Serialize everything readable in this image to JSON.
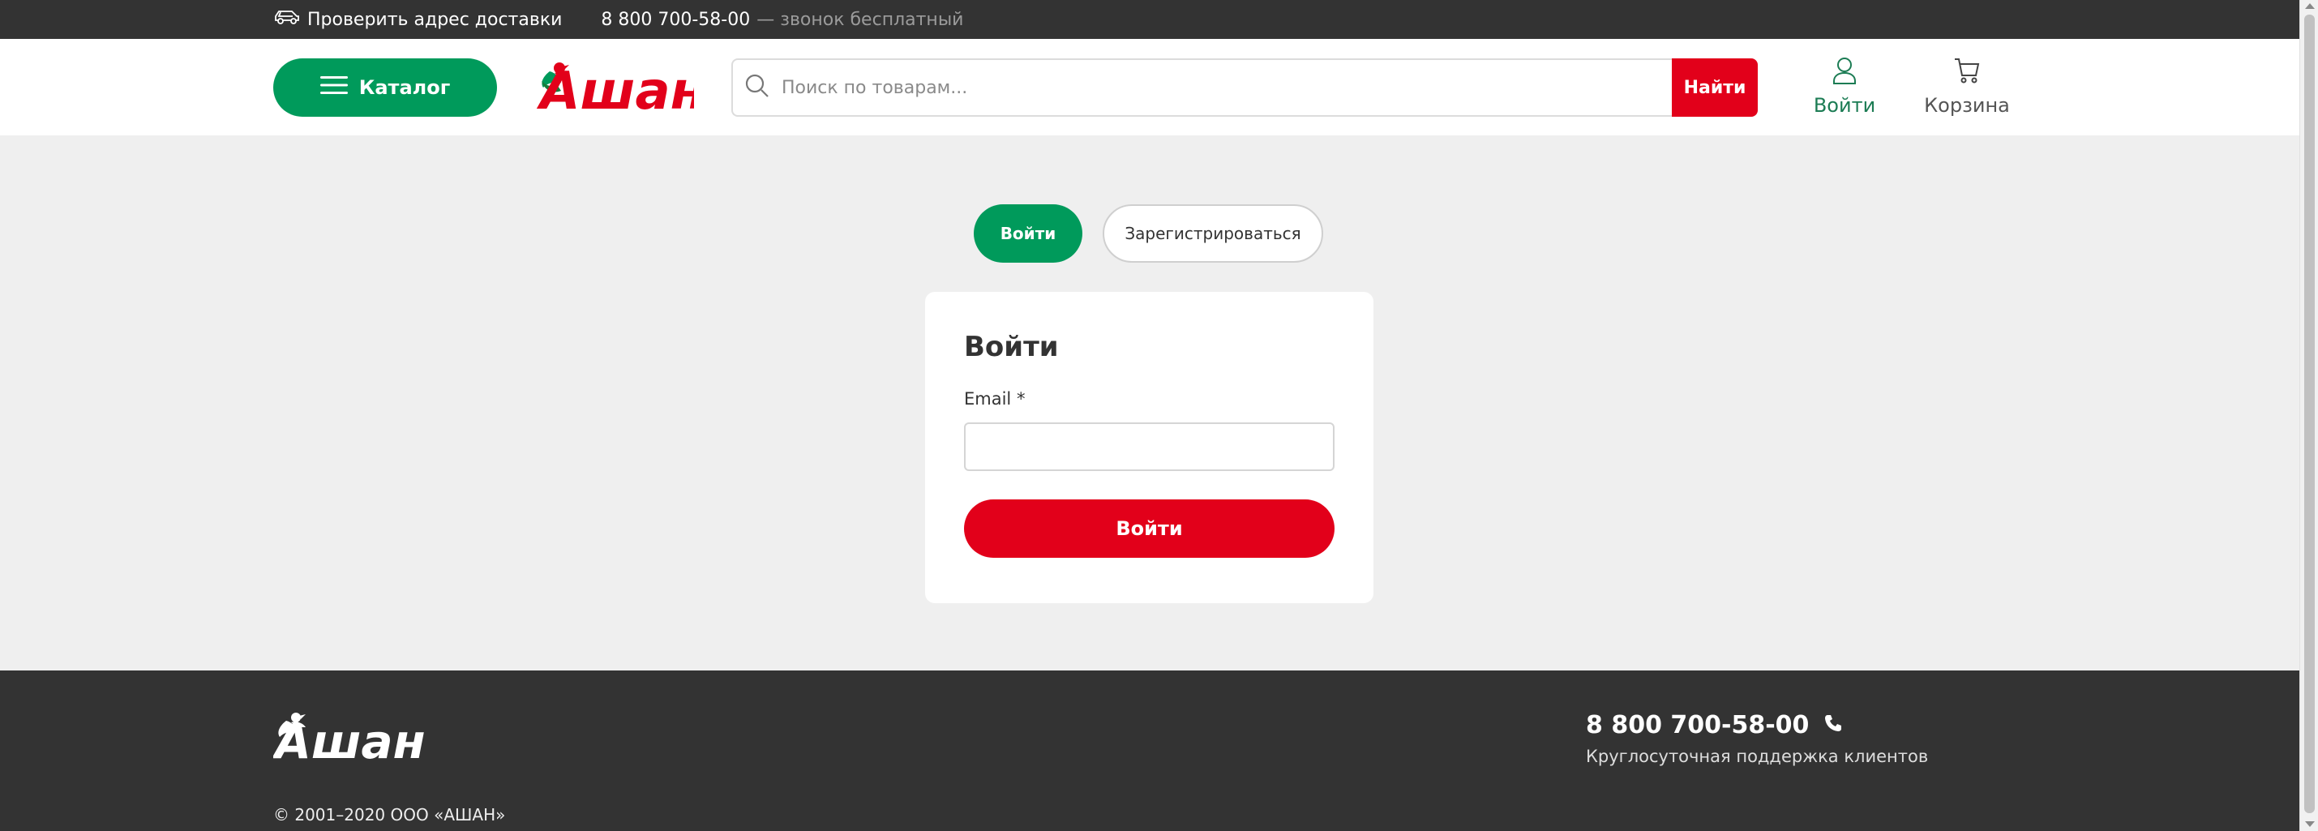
{
  "topbar": {
    "delivery_label": "Проверить адрес доставки",
    "phone": "8 800 700-58-00",
    "phone_note": "— звонок бесплатный"
  },
  "header": {
    "catalog_label": "Каталог",
    "logo_text": "Ашан",
    "search_placeholder": "Поиск по товарам...",
    "search_button": "Найти",
    "login_label": "Войти",
    "cart_label": "Корзина"
  },
  "auth": {
    "tab_login": "Войти",
    "tab_register": "Зарегистрироваться",
    "title": "Войти",
    "email_label": "Email *",
    "email_value": "",
    "submit_label": "Войти"
  },
  "footer": {
    "logo_text": "Ашан",
    "phone": "8 800 700-58-00",
    "support_text": "Круглосуточная поддержка клиентов",
    "copyright": "© 2001–2020 ООО «АШАН»"
  },
  "colors": {
    "brand_green": "#009a5b",
    "brand_red": "#e2001a",
    "dark_bar": "#333333",
    "page_bg": "#efefef"
  },
  "icons": [
    "car-icon",
    "menu-icon",
    "auchan-bird-logo",
    "search-icon",
    "user-icon",
    "cart-icon",
    "phone-icon"
  ]
}
